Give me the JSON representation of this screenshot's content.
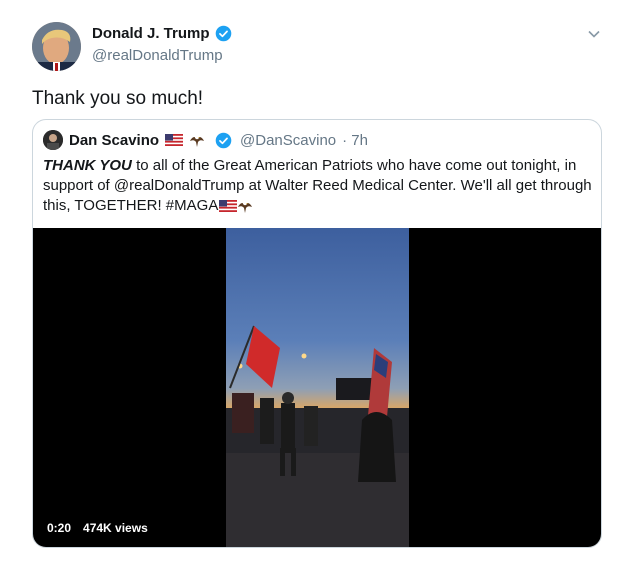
{
  "author": {
    "name": "Donald J. Trump",
    "handle": "@realDonaldTrump"
  },
  "tweet_text": "Thank you so much!",
  "quoted": {
    "name": "Dan Scavino",
    "handle": "@DanScavino",
    "time": "· 7h",
    "text_bold": "THANK YOU",
    "text_body": " to all of the Great American Patriots who have come out tonight, in support of @realDonaldTrump at Walter Reed Medical Center. We'll all get through this, TOGETHER! #MAGA",
    "video": {
      "duration": "0:20",
      "views": "474K views"
    }
  },
  "colors": {
    "verified": "#1da1f2",
    "secondary_text": "#657786",
    "border": "#ccd6dd"
  },
  "icons": [
    "verified-icon",
    "chevron-down-icon",
    "us-flag-icon",
    "eagle-icon"
  ]
}
